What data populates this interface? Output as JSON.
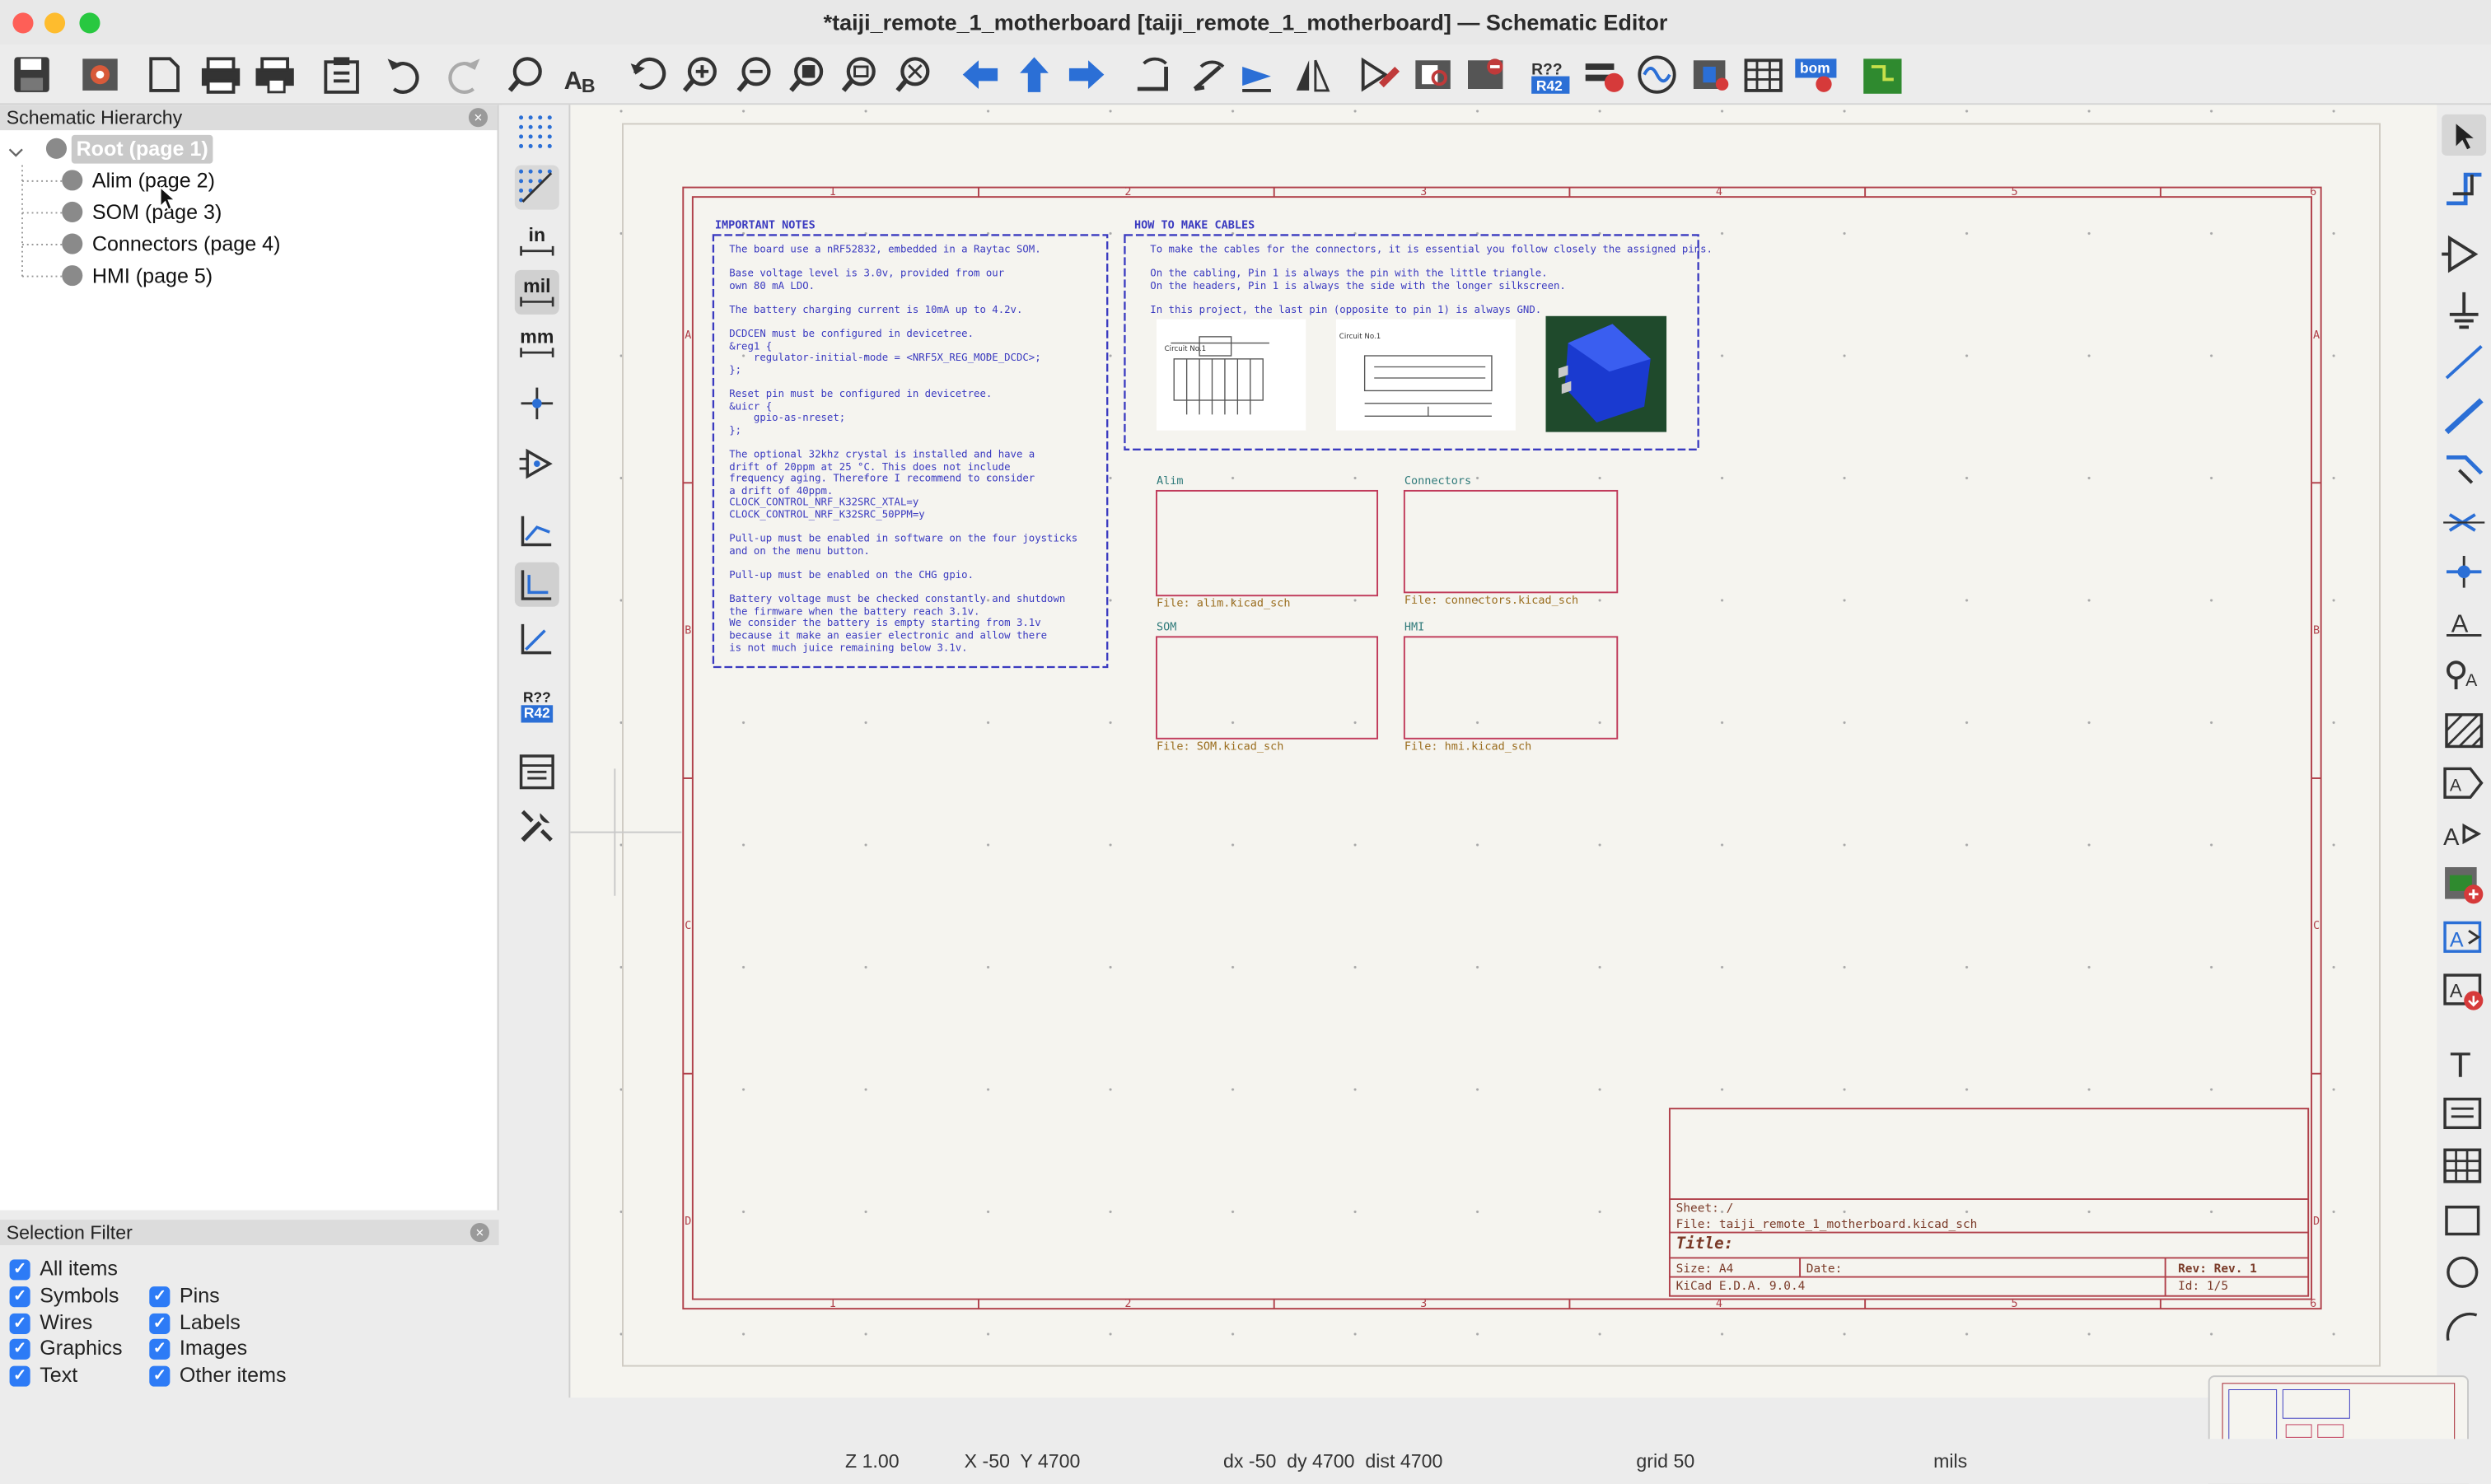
{
  "window": {
    "title": "*taiji_remote_1_motherboard [taiji_remote_1_motherboard] — Schematic Editor"
  },
  "colors": {
    "accent": "#2d7bf6",
    "sheet_border": "#c03a5a",
    "notes_text": "#3a3ac0",
    "canvas_bg": "#f5f4ef",
    "frame": "#b0404a"
  },
  "toolbar": {
    "icons": [
      "save-icon",
      "schematic-setup-icon",
      "new-page-icon",
      "print-icon",
      "plot-icon",
      "paste-icon",
      "undo-icon",
      "redo-icon",
      "find-icon",
      "find-replace-icon",
      "refresh-icon",
      "zoom-in-icon",
      "zoom-out-icon",
      "zoom-fit-icon",
      "zoom-objects-icon",
      "zoom-selection-icon",
      "navigate-back-icon",
      "navigate-up-icon",
      "navigate-forward-icon",
      "rotate-ccw-icon",
      "rotate-cw-icon",
      "mirror-vertical-icon",
      "mirror-horizontal-icon",
      "symbol-editor-icon",
      "symbol-browser-icon",
      "footprint-assign-icon",
      "annotate-icon",
      "erc-icon",
      "simulator-icon",
      "footprint-editor-icon",
      "field-editor-icon",
      "bom-icon",
      "netlist-icon",
      "pcb-editor-icon"
    ]
  },
  "hierarchy": {
    "header": "Schematic Hierarchy",
    "items": [
      {
        "label": "Root (page 1)",
        "selected": true
      },
      {
        "label": "Alim (page 2)"
      },
      {
        "label": "SOM (page 3)"
      },
      {
        "label": "Connectors (page 4)"
      },
      {
        "label": "HMI (page 5)"
      }
    ]
  },
  "selection_filter": {
    "header": "Selection Filter",
    "items": [
      {
        "label": "All items",
        "checked": true
      },
      {
        "label": "Symbols",
        "checked": true
      },
      {
        "label": "Pins",
        "checked": true
      },
      {
        "label": "Wires",
        "checked": true
      },
      {
        "label": "Labels",
        "checked": true
      },
      {
        "label": "Graphics",
        "checked": true
      },
      {
        "label": "Images",
        "checked": true
      },
      {
        "label": "Text",
        "checked": true
      },
      {
        "label": "Other items",
        "checked": true
      }
    ]
  },
  "left_tools": {
    "units_in": "in",
    "units_mil": "mil",
    "units_mm": "mm",
    "annotate_top": "R??",
    "annotate_bottom": "R42"
  },
  "schematic": {
    "column_labels": [
      "1",
      "2",
      "3",
      "4",
      "5",
      "6"
    ],
    "row_labels": [
      "A",
      "B",
      "C",
      "D"
    ],
    "notes": {
      "title": "IMPORTANT NOTES",
      "body": "The board use a nRF52832, embedded in a Raytac SOM.\n\nBase voltage level is 3.0v, provided from our\nown 80 mA LDO.\n\nThe battery charging current is 10mA up to 4.2v.\n\nDCDCEN must be configured in devicetree.\n&reg1 {\n    regulator-initial-mode = <NRF5X_REG_MODE_DCDC>;\n};\n\nReset pin must be configured in devicetree.\n&uicr {\n    gpio-as-nreset;\n};\n\nThe optional 32khz crystal is installed and have a\ndrift of 20ppm at 25 °C. This does not include\nfrequency aging. Therefore I recommend to consider\na drift of 40ppm.\nCLOCK_CONTROL_NRF_K32SRC_XTAL=y\nCLOCK_CONTROL_NRF_K32SRC_50PPM=y\n\nPull-up must be enabled in software on the four joysticks\nand on the menu button.\n\nPull-up must be enabled on the CHG gpio.\n\nBattery voltage must be checked constantly and shutdown\nthe firmware when the battery reach 3.1v.\nWe consider the battery is empty starting from 3.1v\nbecause it make an easier electronic and allow there\nis not much juice remaining below 3.1v."
    },
    "cables": {
      "title": "HOW TO MAKE CABLES",
      "body": "To make the cables for the connectors, it is essential you follow closely the assigned pins.\n\nOn the cabling, Pin 1 is always the pin with the little triangle.\nOn the headers, Pin 1 is always the side with the longer silkscreen.\n\nIn this project, the last pin (opposite to pin 1) is always GND.",
      "circuit_label": "Circuit No.1"
    },
    "sheets": [
      {
        "name": "Alim",
        "file": "File: alim.kicad_sch"
      },
      {
        "name": "Connectors",
        "file": "File: connectors.kicad_sch"
      },
      {
        "name": "SOM",
        "file": "File: SOM.kicad_sch"
      },
      {
        "name": "HMI",
        "file": "File: hmi.kicad_sch"
      }
    ],
    "title_block": {
      "sheet": "Sheet: /",
      "file": "File: taiji_remote_1_motherboard.kicad_sch",
      "title": "Title:",
      "size": "Size: A4",
      "date": "Date:",
      "rev": "Rev: Rev. 1",
      "tool": "KiCad E.D.A. 9.0.4",
      "id": "Id: 1/5"
    }
  },
  "right_tools": [
    "select-icon",
    "interactive-router-icon",
    "add-symbol-icon",
    "add-power-icon",
    "add-wire-icon",
    "add-bus-icon",
    "add-bus-entry-icon",
    "no-connect-icon",
    "junction-icon",
    "net-label-icon",
    "net-class-label-icon",
    "rule-area-icon",
    "global-label-icon",
    "hierarchical-label-icon",
    "add-sheet-icon",
    "import-sheet-pin-icon",
    "import-hierarchical-label-icon",
    "add-text-icon",
    "add-textbox-icon",
    "add-table-icon",
    "add-rectangle-icon",
    "add-circle-icon",
    "add-arc-icon"
  ],
  "status": {
    "zoom": "Z 1.00",
    "xy": "X -50  Y 4700",
    "delta": "dx -50  dy 4700  dist 4700",
    "grid": "grid 50",
    "units": "mils"
  }
}
